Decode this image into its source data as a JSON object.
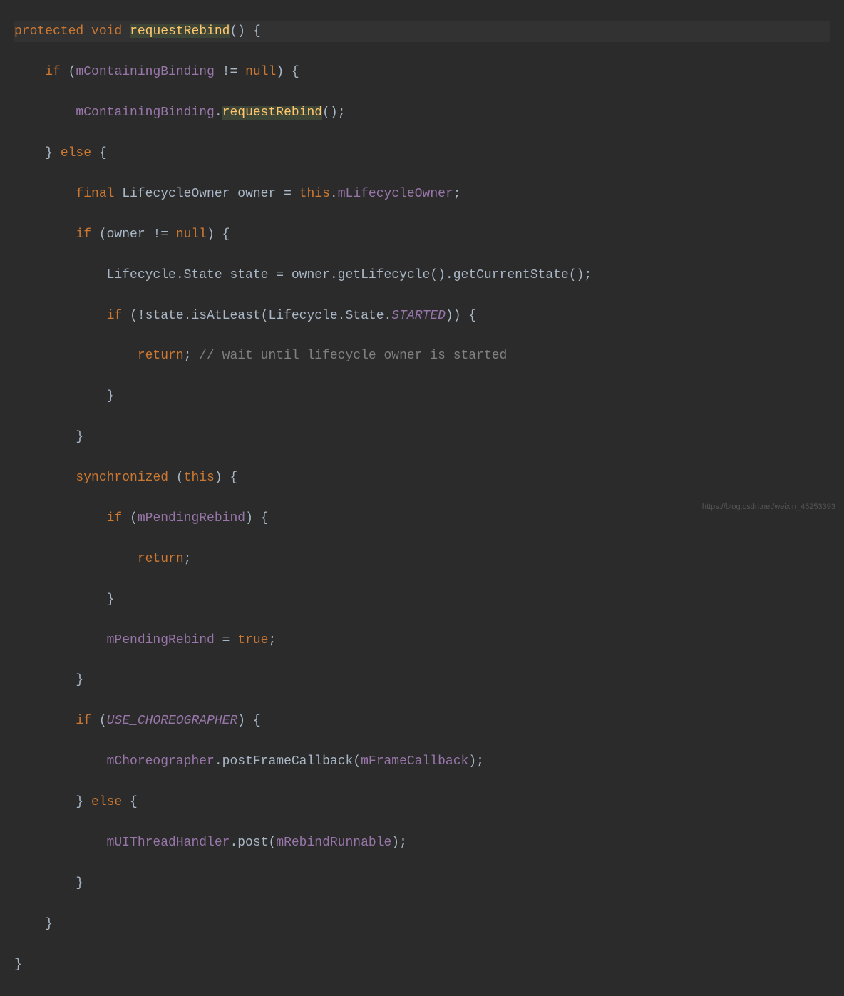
{
  "code": {
    "line1": {
      "kw1": "protected",
      "kw2": "void",
      "method": "requestRebind",
      "parens": "() {"
    },
    "line2": {
      "kw": "if",
      "open": " (",
      "field": "mContainingBinding",
      "op": " != ",
      "null": "null",
      "close": ") {"
    },
    "line3": {
      "field": "mContainingBinding",
      "dot": ".",
      "method": "requestRebind",
      "parens": "();"
    },
    "line4": {
      "close": "} ",
      "kw": "else",
      "open": " {"
    },
    "line5": {
      "kw": "final",
      "type": " LifecycleOwner owner = ",
      "this": "this",
      "dot": ".",
      "field": "mLifecycleOwner",
      "semi": ";"
    },
    "line6": {
      "kw": "if",
      "open": " (owner != ",
      "null": "null",
      "close": ") {"
    },
    "line7": {
      "text": "Lifecycle.State state = owner.getLifecycle().getCurrentState();"
    },
    "line8": {
      "kw": "if",
      "open": " (!state.isAtLeast(Lifecycle.State.",
      "static": "STARTED",
      "close": ")) {"
    },
    "line9": {
      "kw": "return",
      "semi": "; ",
      "comment": "// wait until lifecycle owner is started"
    },
    "line10": {
      "brace": "}"
    },
    "line11": {
      "brace": "}"
    },
    "line12": {
      "kw": "synchronized",
      "open": " (",
      "this": "this",
      "close": ") {"
    },
    "line13": {
      "kw": "if",
      "open": " (",
      "field": "mPendingRebind",
      "close": ") {"
    },
    "line14": {
      "kw": "return",
      "semi": ";"
    },
    "line15": {
      "brace": "}"
    },
    "line16": {
      "field": "mPendingRebind",
      "op": " = ",
      "true": "true",
      "semi": ";"
    },
    "line17": {
      "brace": "}"
    },
    "line18": {
      "kw": "if",
      "open": " (",
      "static": "USE_CHOREOGRAPHER",
      "close": ") {"
    },
    "line19": {
      "field1": "mChoreographer",
      "dot": ".postFrameCallback(",
      "field2": "mFrameCallback",
      "close": ");"
    },
    "line20": {
      "close": "} ",
      "kw": "else",
      "open": " {"
    },
    "line21": {
      "field1": "mUIThreadHandler",
      "dot": ".post(",
      "field2": "mRebindRunnable",
      "close": ");"
    },
    "line22": {
      "brace": "}"
    },
    "line23": {
      "brace": "}"
    },
    "line24": {
      "brace": "}"
    }
  },
  "watermark": "https://blog.csdn.net/weixin_45253393"
}
